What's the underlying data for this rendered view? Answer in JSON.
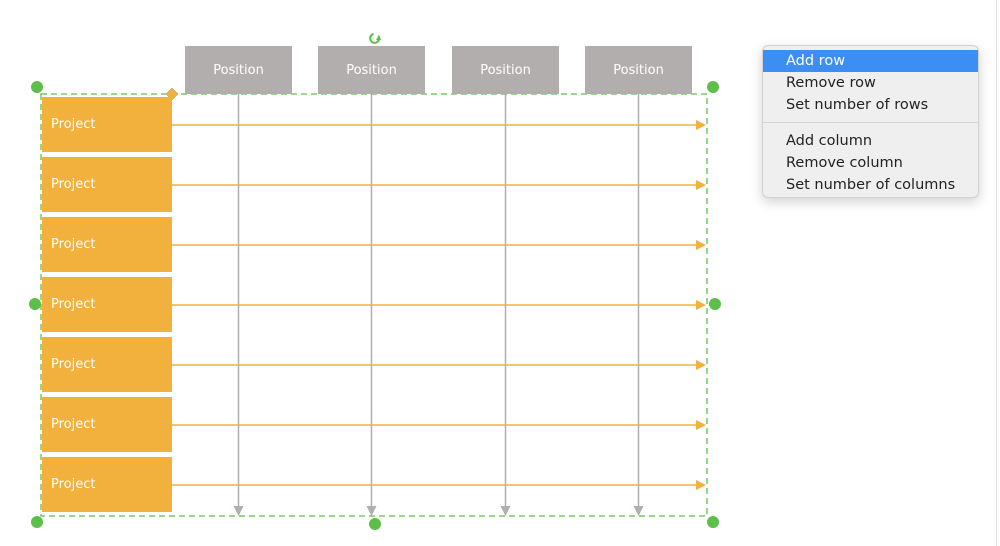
{
  "diagram": {
    "columns": [
      {
        "label": "Position"
      },
      {
        "label": "Position"
      },
      {
        "label": "Position"
      },
      {
        "label": "Position"
      }
    ],
    "rows": [
      {
        "label": "Project"
      },
      {
        "label": "Project"
      },
      {
        "label": "Project"
      },
      {
        "label": "Project"
      },
      {
        "label": "Project"
      },
      {
        "label": "Project"
      },
      {
        "label": "Project"
      }
    ],
    "colors": {
      "column_header": "#b3aeae",
      "column_line": "#b3aeae",
      "row_header": "#f2b03d",
      "row_arrow": "#f2b03d",
      "selection": "#5cbf4a",
      "corner_handle": "#f2b03d"
    },
    "selected": true
  },
  "context_menu": {
    "groups": [
      {
        "items": [
          {
            "label": "Add row",
            "highlighted": true
          },
          {
            "label": "Remove row",
            "highlighted": false
          },
          {
            "label": "Set number of rows",
            "highlighted": false
          }
        ]
      },
      {
        "items": [
          {
            "label": "Add column",
            "highlighted": false
          },
          {
            "label": "Remove column",
            "highlighted": false
          },
          {
            "label": "Set number of columns",
            "highlighted": false
          }
        ]
      }
    ],
    "highlight_color": "#3d8ef3"
  }
}
